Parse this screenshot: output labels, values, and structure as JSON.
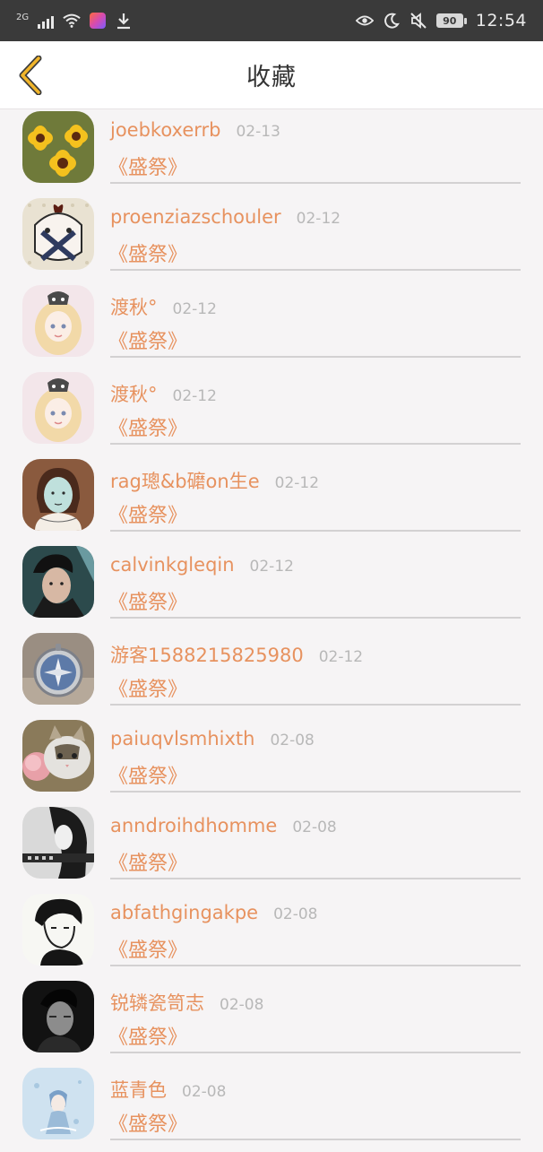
{
  "status_bar": {
    "network": "2G",
    "battery": "90",
    "time": "12:54"
  },
  "header": {
    "title": "收藏"
  },
  "favorites": [
    {
      "name": "joebkoxerrb",
      "date": "02-13",
      "work": "《盛祭》"
    },
    {
      "name": "proenziazschouler",
      "date": "02-12",
      "work": "《盛祭》"
    },
    {
      "name": "渡秋°",
      "date": "02-12",
      "work": "《盛祭》"
    },
    {
      "name": "渡秋°",
      "date": "02-12",
      "work": "《盛祭》"
    },
    {
      "name": "rag璁&b礳on生e",
      "date": "02-12",
      "work": "《盛祭》"
    },
    {
      "name": "calvinkgleqin",
      "date": "02-12",
      "work": "《盛祭》"
    },
    {
      "name": "游客1588215825980",
      "date": "02-12",
      "work": "《盛祭》"
    },
    {
      "name": "paiuqvlsmhixth",
      "date": "02-08",
      "work": "《盛祭》"
    },
    {
      "name": "anndroihdhomme",
      "date": "02-08",
      "work": "《盛祭》"
    },
    {
      "name": "abfathgingakpe",
      "date": "02-08",
      "work": "《盛祭》"
    },
    {
      "name": "锐辚瓷笥志",
      "date": "02-08",
      "work": "《盛祭》"
    },
    {
      "name": "蓝青色",
      "date": "02-08",
      "work": "《盛祭》"
    }
  ],
  "colors": {
    "accent": "#e7925f",
    "date_gray": "#b8b8b8",
    "back_icon": "#f1b52a",
    "status_bar_bg": "#3a3a3a"
  },
  "icons": {
    "back": "chevron-left-icon",
    "status": [
      "signal-icon",
      "wifi-icon",
      "app-notification-icon",
      "download-icon",
      "eye-icon",
      "moon-icon",
      "mute-icon",
      "battery-icon"
    ]
  }
}
